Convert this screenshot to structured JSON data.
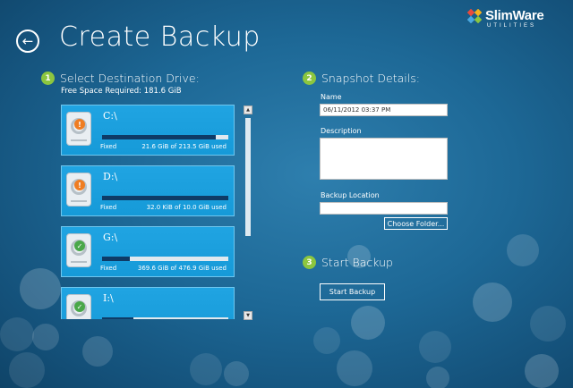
{
  "header": {
    "title": "Create Backup",
    "back_icon": "back-arrow-icon",
    "logo_text": "SlimWare",
    "logo_sub": "UTILITIES"
  },
  "steps": [
    {
      "number": "1",
      "label": "Select Destination Drive:"
    },
    {
      "number": "2",
      "label": "Snapshot Details:"
    },
    {
      "number": "3",
      "label": "Start Backup"
    }
  ],
  "destination": {
    "free_space": "Free Space Required: 181.6 GiB",
    "drives": [
      {
        "letter": "C:\\",
        "type": "Fixed",
        "usage": "21.6 GiB of 213.5 GiB used",
        "used_fraction": 0.9,
        "status": "warning"
      },
      {
        "letter": "D:\\",
        "type": "Fixed",
        "usage": "32.0 KiB of 10.0 GiB used",
        "used_fraction": 1.0,
        "status": "warning"
      },
      {
        "letter": "G:\\",
        "type": "Fixed",
        "usage": "369.6 GiB of 476.9 GiB used",
        "used_fraction": 0.22,
        "status": "ok"
      },
      {
        "letter": "I:\\",
        "type": "",
        "usage": "",
        "used_fraction": 0.25,
        "status": "ok"
      }
    ]
  },
  "snapshot": {
    "name_label": "Name",
    "name_value": "06/11/2012 03:37 PM",
    "description_label": "Description",
    "description_value": "",
    "location_label": "Backup Location",
    "location_value": "",
    "choose_folder": "Choose Folder..."
  },
  "start": {
    "button": "Start Backup"
  },
  "colors": {
    "background": "#1d6896",
    "card": "#1ca0de",
    "step_badge": "#8cc63f",
    "warning": "#ef7d22",
    "ok": "#4aa84a"
  }
}
